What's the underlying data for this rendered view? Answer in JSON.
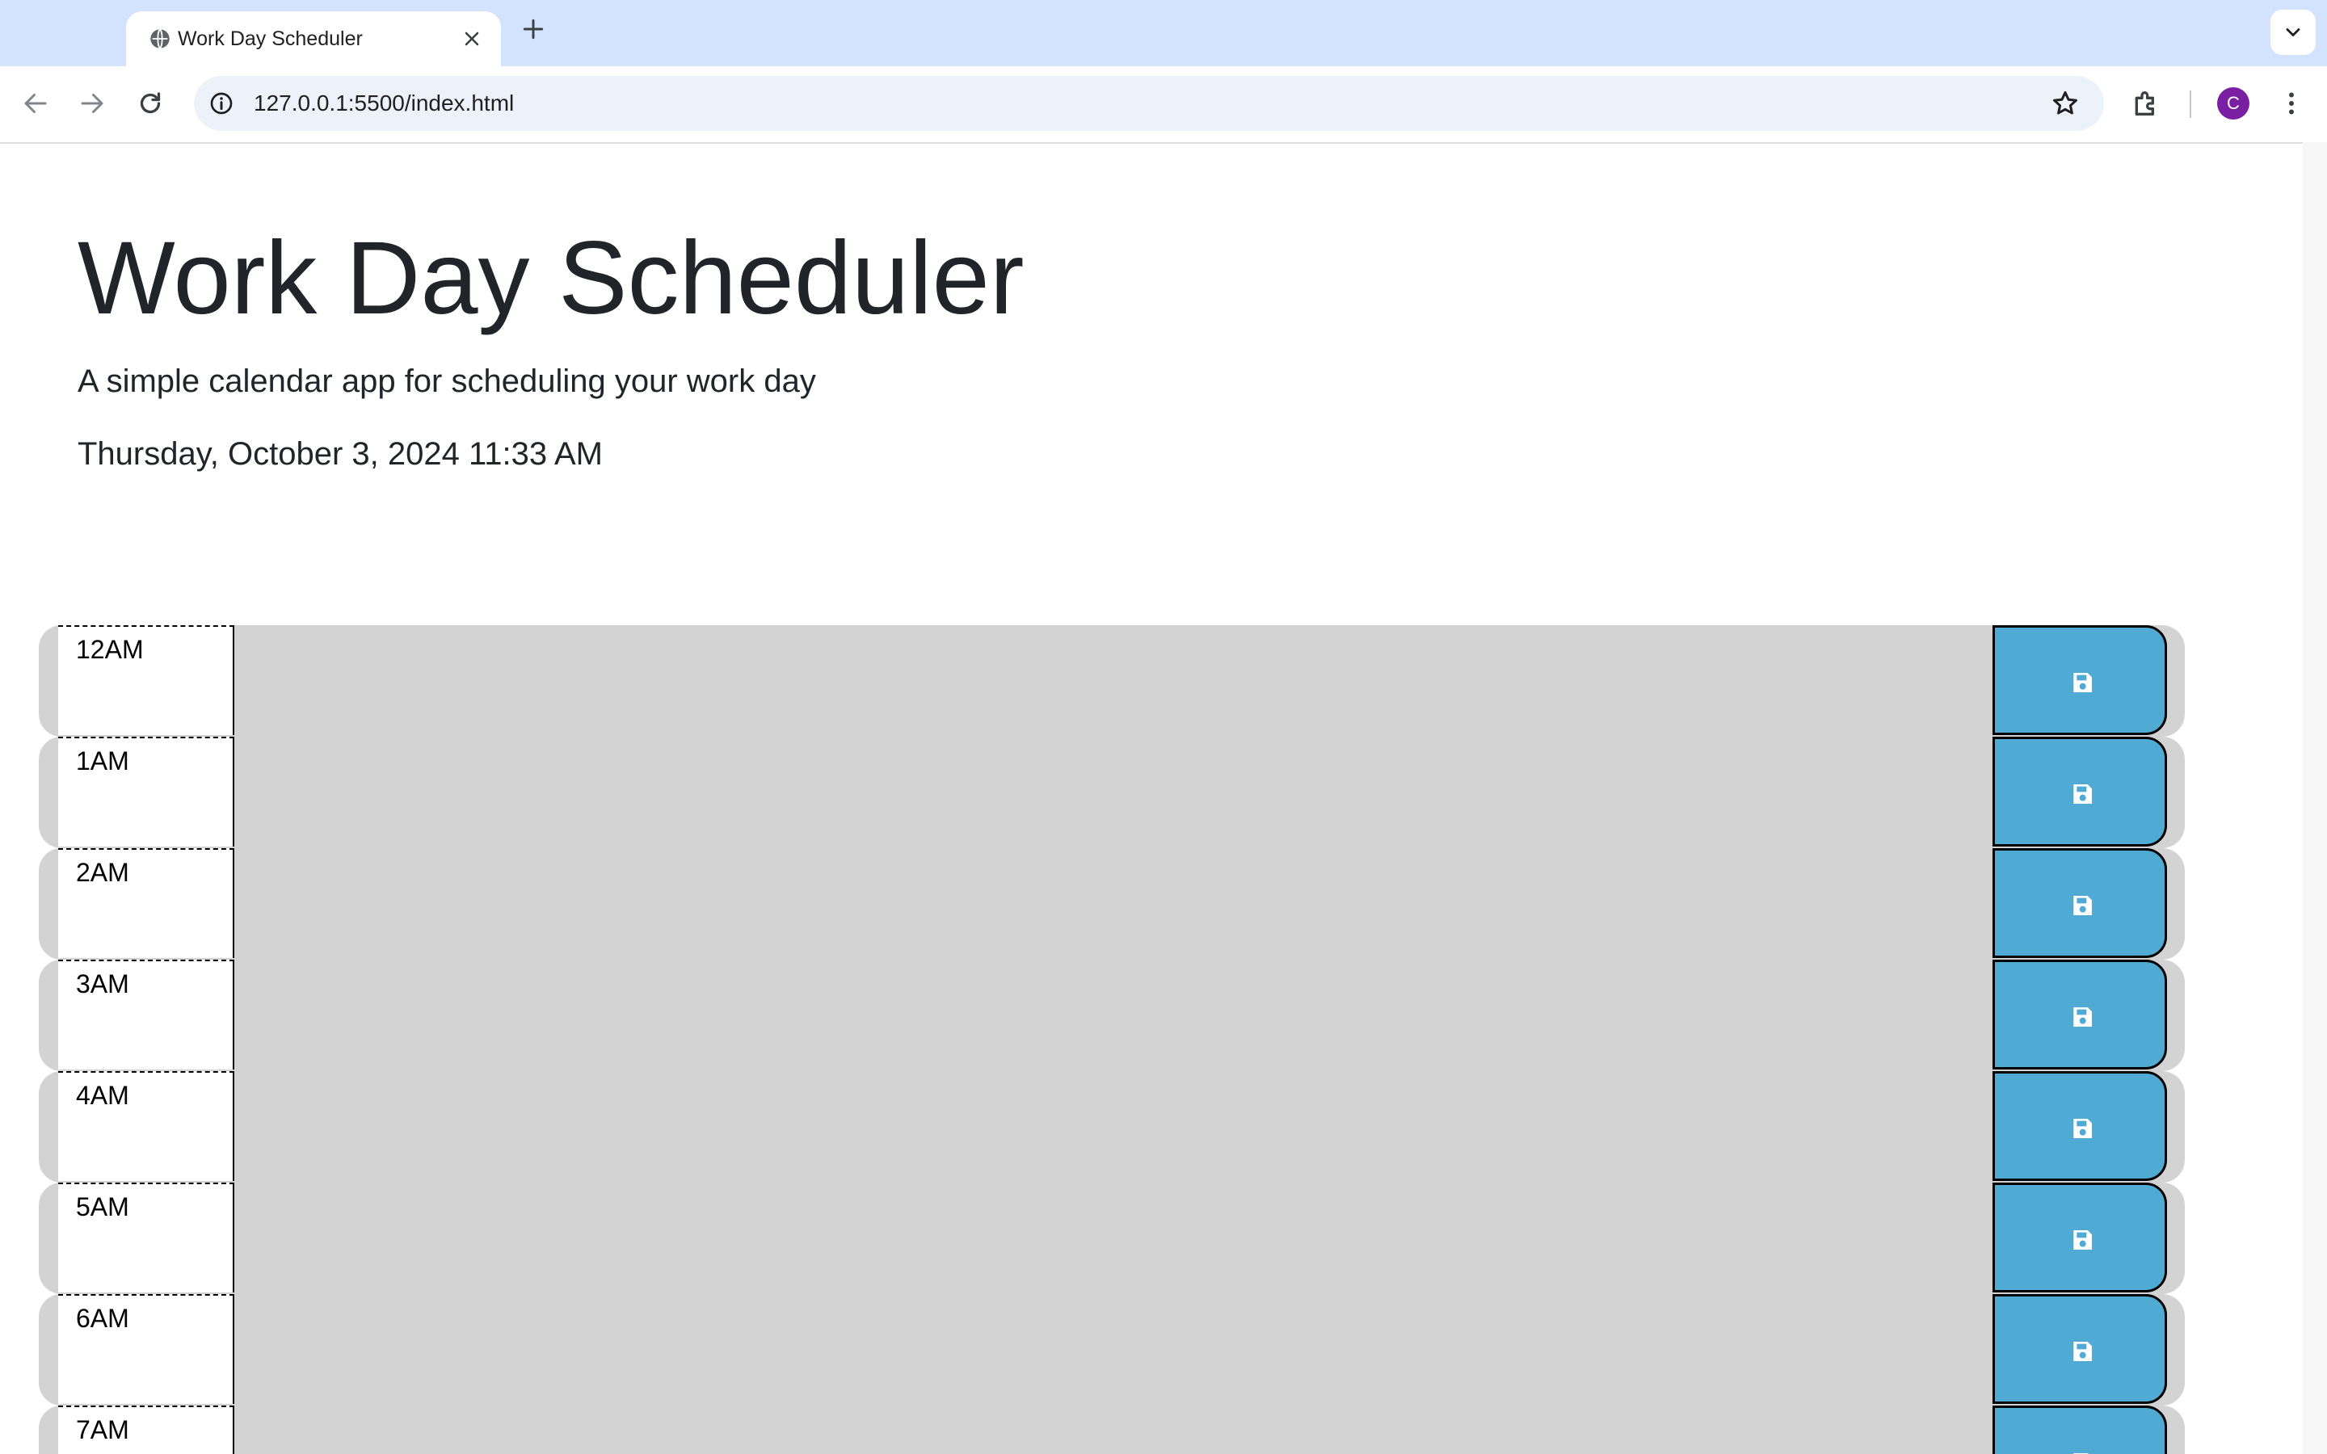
{
  "browser": {
    "tab_title": "Work Day Scheduler",
    "url": "127.0.0.1:5500/index.html",
    "profile_initial": "C",
    "icons": [
      "globe-icon",
      "close-icon",
      "plus-icon",
      "chevron-down-icon",
      "back-icon",
      "forward-icon",
      "reload-icon",
      "info-icon",
      "star-icon",
      "puzzle-icon",
      "more-vert-icon"
    ]
  },
  "header": {
    "title": "Work Day Scheduler",
    "lead": "A simple calendar app for scheduling your work day",
    "current_day": "Thursday, October 3, 2024 11:33 AM"
  },
  "schedule": {
    "hours": [
      {
        "label": "12AM",
        "text": ""
      },
      {
        "label": "1AM",
        "text": ""
      },
      {
        "label": "2AM",
        "text": ""
      },
      {
        "label": "3AM",
        "text": ""
      },
      {
        "label": "4AM",
        "text": ""
      },
      {
        "label": "5AM",
        "text": ""
      },
      {
        "label": "6AM",
        "text": ""
      },
      {
        "label": "7AM",
        "text": ""
      }
    ],
    "save_icon": "save-icon",
    "colors": {
      "past": "#d3d3d3",
      "save_button": "#4fabd3"
    }
  }
}
